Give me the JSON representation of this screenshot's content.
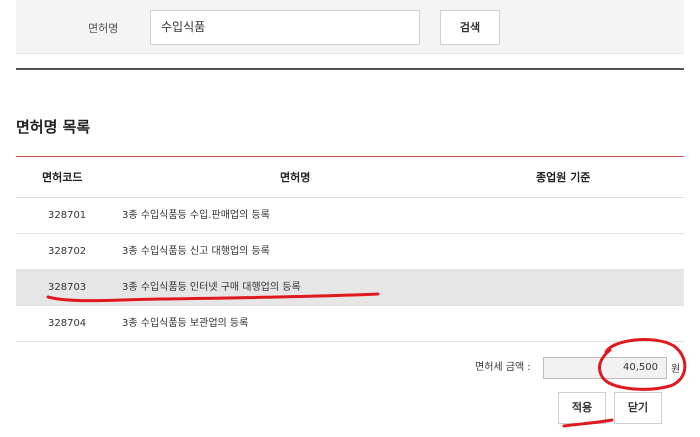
{
  "search": {
    "label": "면허명",
    "value": "수입식품",
    "button_label": "검색"
  },
  "list": {
    "title": "면허명 목록",
    "columns": [
      "면허코드",
      "면허명",
      "종업원 기준"
    ],
    "rows": [
      {
        "code": "328701",
        "name": "3종 수입식품등 수입.판매업의 등록",
        "staff": ""
      },
      {
        "code": "328702",
        "name": "3종 수입식품등 신고 대행업의 등록",
        "staff": ""
      },
      {
        "code": "328703",
        "name": "3종 수입식품등 인터넷 구매 대행업의 등록",
        "staff": "",
        "selected": true
      },
      {
        "code": "328704",
        "name": "3종 수입식품등 보관업의 등록",
        "staff": ""
      }
    ]
  },
  "fee": {
    "label": "면허세 금액 :",
    "value": "40,500",
    "unit": "원"
  },
  "actions": {
    "apply_label": "적용",
    "close_label": "닫기"
  },
  "colors": {
    "table_header_border": "#c8554a",
    "selected_row": "#e6e6e6",
    "annotation": "#e0191f"
  }
}
